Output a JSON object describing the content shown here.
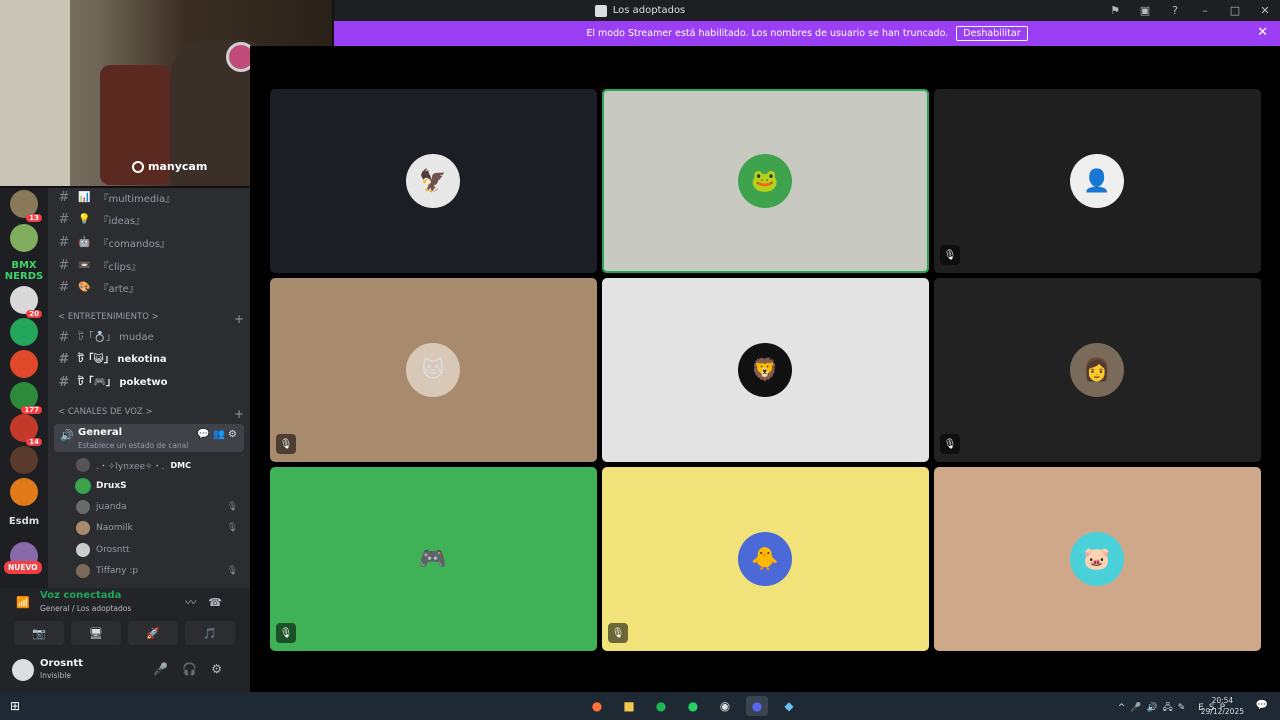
{
  "window": {
    "title": "Los adoptados"
  },
  "banner": {
    "text": "El modo Streamer está habilitado. Los nombres de usuario se han truncado.",
    "button": "Deshabilitar"
  },
  "webcam": {
    "watermark": "manycam"
  },
  "servers": {
    "badges": [
      "13",
      "20",
      "177",
      "14"
    ],
    "label_bmx": "BMX NERDS",
    "label_esdm": "Esdm",
    "nuevo": "NUEVO"
  },
  "channels": {
    "text": [
      {
        "name": "『multimedia』",
        "emoji": "📊"
      },
      {
        "name": "『ideas』",
        "emoji": "💡"
      },
      {
        "name": "『comandos』",
        "emoji": "🤖"
      },
      {
        "name": "『clips』",
        "emoji": "📼"
      },
      {
        "name": "『arte』",
        "emoji": "🎨"
      }
    ],
    "cat_entretenimiento": "< ENTRETENIMIENTO >",
    "ent": [
      {
        "name": "ট「💍」 mudae",
        "bold": false
      },
      {
        "name": "ট「😺」 nekotina",
        "bold": true
      },
      {
        "name": "ট「🎮」 poketwo",
        "bold": true
      }
    ],
    "cat_voz": "< CANALES DE VOZ >",
    "general": {
      "name": "General",
      "status": "Establece un estado de canal"
    },
    "voice_users": [
      {
        "name": ".・✧lynxee✧・.",
        "tag": "DMC",
        "speak": false,
        "muted": false
      },
      {
        "name": "DruxS",
        "tag": "",
        "speak": true,
        "muted": false
      },
      {
        "name": "juanda",
        "tag": "",
        "speak": false,
        "muted": true
      },
      {
        "name": "Naomilk",
        "tag": "",
        "speak": false,
        "muted": true
      },
      {
        "name": "Orosntt",
        "tag": "",
        "speak": false,
        "muted": false
      },
      {
        "name": "Tiffany :p",
        "tag": "",
        "speak": false,
        "muted": true
      }
    ]
  },
  "voice": {
    "connected": "Voz conectada",
    "location": "General / Los adoptados"
  },
  "user": {
    "name": "Orosntt",
    "status": "Invisible"
  },
  "tiles": [
    {
      "bg": "#1c1e25",
      "avatar_bg": "#e8e8e8",
      "glyph": "🦅",
      "muted": false,
      "speaking": false
    },
    {
      "bg": "#c8cac2",
      "avatar_bg": "#3fa34d",
      "glyph": "🐸",
      "muted": false,
      "speaking": true
    },
    {
      "bg": "#1f1f1f",
      "avatar_bg": "#efefef",
      "glyph": "👤",
      "muted": true,
      "speaking": false
    },
    {
      "bg": "#a88a6c",
      "avatar_bg": "#d8c8b8",
      "glyph": "🐱",
      "muted": true,
      "speaking": false
    },
    {
      "bg": "#e3e3e3",
      "avatar_bg": "#111111",
      "glyph": "🦁",
      "muted": false,
      "speaking": false
    },
    {
      "bg": "#222222",
      "avatar_bg": "#7a6a5a",
      "glyph": "👩",
      "muted": true,
      "speaking": false
    },
    {
      "bg": "#3fb157",
      "avatar_bg": "#3fb157",
      "glyph": "🎮",
      "muted": true,
      "speaking": false
    },
    {
      "bg": "#f1e37a",
      "avatar_bg": "#4b6ad8",
      "glyph": "🐥",
      "muted": true,
      "speaking": false
    },
    {
      "bg": "#cfa88a",
      "avatar_bg": "#4ad0d8",
      "glyph": "🐷",
      "muted": false,
      "speaking": false
    }
  ],
  "taskbar": {
    "lang": "ESP",
    "time": "20:54",
    "date": "29/12/2025"
  },
  "colors": {
    "accent": "#9b3ff5",
    "green": "#23a55a",
    "red": "#f23f43"
  }
}
